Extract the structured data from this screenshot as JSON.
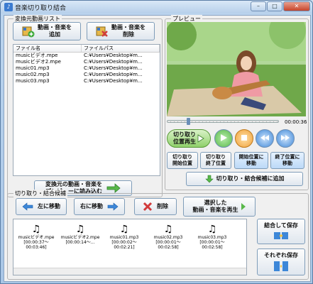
{
  "window": {
    "title": "音楽切り取り結合",
    "min": "–",
    "max": "□",
    "close": "✕"
  },
  "source_group": {
    "label": "変換元動画リスト",
    "add_button": "動画・音楽を\n追加",
    "remove_button": "動画・音楽を\n削除",
    "columns": [
      "ファイル名",
      "ファイルパス"
    ],
    "rows": [
      [
        "musicビデオ.mpe",
        "C:¥Users¥Desktop¥m..."
      ],
      [
        "musicビデオ2.mpe",
        "C:¥Users¥Desktop¥m..."
      ],
      [
        "music01.mp3",
        "C:¥Users¥Desktop¥m..."
      ],
      [
        "music02.mp3",
        "C:¥Users¥Desktop¥m..."
      ],
      [
        "music03.mp3",
        "C:¥Users¥Desktop¥m..."
      ]
    ],
    "load_preview_button": "変換元の動画・音楽を\nプレビューに読み込む"
  },
  "preview_group": {
    "label": "プレビュー",
    "timecode": "00:00:36",
    "cut_play_button": "切り取り\n位置再生",
    "cut_start_button": "切り取り\n開始位置",
    "cut_end_button": "切り取り\n終了位置",
    "move_start_button": "開始位置に\n移動",
    "move_end_button": "終了位置に\n移動",
    "add_candidates_button": "切り取り・結合候補に追加"
  },
  "candidates_group": {
    "label": "切り取り・結合候補",
    "move_left_button": "左に移動",
    "move_right_button": "右に移動",
    "delete_button": "削除",
    "play_selected_button": "選択した\n動画・音楽を再生",
    "items": [
      {
        "name": "musicビデオ.mpe",
        "range": "[00:00:37〜00:03:46]"
      },
      {
        "name": "musicビデオ2.mpe",
        "range": "[00:00:14〜..."
      },
      {
        "name": "music01.mp3",
        "range": "[00:00:02〜00:02:21]"
      },
      {
        "name": "music02.mp3",
        "range": "[00:00:01〜00:02:58]"
      },
      {
        "name": "music03.mp3",
        "range": "[00:00:01〜00:02:58]"
      }
    ],
    "join_save_button": "結合して保存",
    "each_save_button": "それぞれ保存"
  },
  "icons": {
    "app": "app-icon",
    "add": "add-media-icon",
    "remove": "remove-media-icon",
    "play": "play-icon",
    "stop": "stop-icon",
    "rewind": "rewind-icon",
    "forward": "fast-forward-icon",
    "note": "music-note-icon"
  },
  "colors": {
    "accent": "#3d87d8",
    "green": "#58b84a",
    "red": "#d23a3a"
  }
}
